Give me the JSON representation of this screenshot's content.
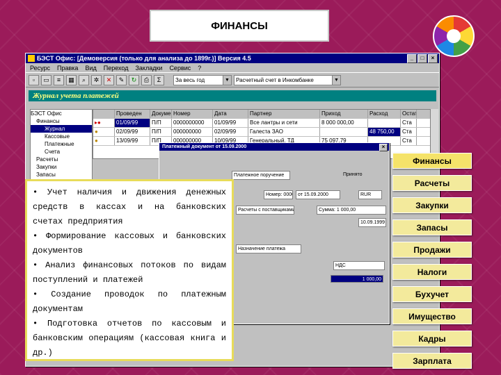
{
  "slide_title": "ФИНАНСЫ",
  "window": {
    "title": "БЭСТ Офис: [Демоверсия (только для анализа до 1899г.)] Версия 4.5",
    "menu": [
      "Ресурс",
      "Правка",
      "Вид",
      "Переход",
      "Закладки",
      "Сервис",
      "?"
    ],
    "combo_org": "За весь год",
    "combo_account": "Расчетный счет в Инкомбанке",
    "journal_title": "Журнал учета платежей",
    "tree": [
      "БЭСТ Офис",
      "Финансы",
      "Журнал",
      "Кассовые",
      "Платежные",
      "Счета",
      "Расчеты",
      "Закупки",
      "Запасы"
    ],
    "grid_headers": [
      "Проведен",
      "Документ",
      "Номер",
      "Дата",
      "Партнер",
      "Приход",
      "Расход",
      "Остаток"
    ],
    "grid_rows": [
      [
        "01/09/99",
        "П/П",
        "0000000000",
        "01/09/99",
        "Все лантры и сети",
        "8 000 000,00",
        "",
        "Ста"
      ],
      [
        "02/09/99",
        "П/П",
        "000000000",
        "02/09/99",
        "Галеста ЗАО",
        "",
        "48 750,00",
        "Ста"
      ],
      [
        "13/09/99",
        "П/П",
        "000000000",
        "10/09/99",
        "Генеральный, ТД",
        "75 097,79",
        "",
        "Ста"
      ]
    ],
    "dialog_title": "Платежный документ от 15.09.2000",
    "dialog_fields": [
      "Платежное поручение",
      "Принято",
      "Номер: 0000",
      "от 15.09.2000",
      "RUR",
      "Сумма: 1 000,00",
      "Расчеты с поставщиками",
      "10.09.1999",
      "Назначение платежа",
      "НДС",
      "1 000,00"
    ]
  },
  "description": [
    "• Учет наличия и движения денежных средств в кассах и на банковских счетах предприятия",
    "• Формирование кассовых и банковских документов",
    "• Анализ финансовых потоков по видам поступлений и платежей",
    "• Создание проводок по платежным документам",
    "• Подготовка отчетов по кассовым и банковским операциям (кассовая книга и др.)"
  ],
  "modules": [
    "Финансы",
    "Расчеты",
    "Закупки",
    "Запасы",
    "Продажи",
    "Налоги",
    "Бухучет",
    "Имущество",
    "Кадры",
    "Зарплата"
  ]
}
